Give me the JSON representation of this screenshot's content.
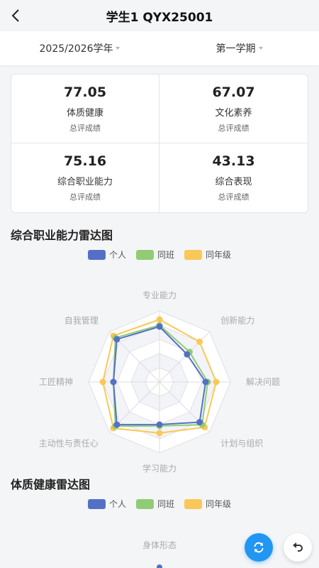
{
  "header": {
    "title": "学生1 QYX25001"
  },
  "filters": {
    "year": "2025/2026学年",
    "term": "第一学期"
  },
  "scores": [
    {
      "value": "77.05",
      "name": "体质健康",
      "sub": "总评成绩"
    },
    {
      "value": "67.07",
      "name": "文化素养",
      "sub": "总评成绩"
    },
    {
      "value": "75.16",
      "name": "综合职业能力",
      "sub": "总评成绩"
    },
    {
      "value": "43.13",
      "name": "综合表现",
      "sub": "总评成绩"
    }
  ],
  "colors": {
    "personal": "#5470c6",
    "class": "#91cc75",
    "grade": "#fac858",
    "accent": "#2196f3"
  },
  "radar1": {
    "title": "综合职业能力雷达图",
    "legend": [
      "个人",
      "同班",
      "同年级"
    ],
    "chart_data": {
      "type": "radar",
      "categories": [
        "专业能力",
        "创新能力",
        "解决问题",
        "计划与组织",
        "学习能力",
        "主动性与责任心",
        "工匠精神",
        "自我管理"
      ],
      "range": [
        0,
        100
      ],
      "series": [
        {
          "name": "个人",
          "values": [
            78,
            55,
            65,
            80,
            60,
            85,
            65,
            85
          ]
        },
        {
          "name": "同班",
          "values": [
            80,
            60,
            68,
            85,
            62,
            88,
            65,
            88
          ]
        },
        {
          "name": "同年级",
          "values": [
            88,
            80,
            80,
            90,
            72,
            92,
            80,
            92
          ]
        }
      ]
    }
  },
  "radar2": {
    "title": "体质健康雷达图",
    "legend": [
      "个人",
      "同班",
      "同年级"
    ],
    "chart_data": {
      "type": "radar",
      "categories": [
        "身体形态"
      ],
      "series": [
        {
          "name": "个人"
        },
        {
          "name": "同班"
        },
        {
          "name": "同年级"
        }
      ]
    }
  },
  "icons": {
    "back": "chevron-left-icon",
    "refresh": "refresh-icon",
    "return": "undo-icon"
  }
}
